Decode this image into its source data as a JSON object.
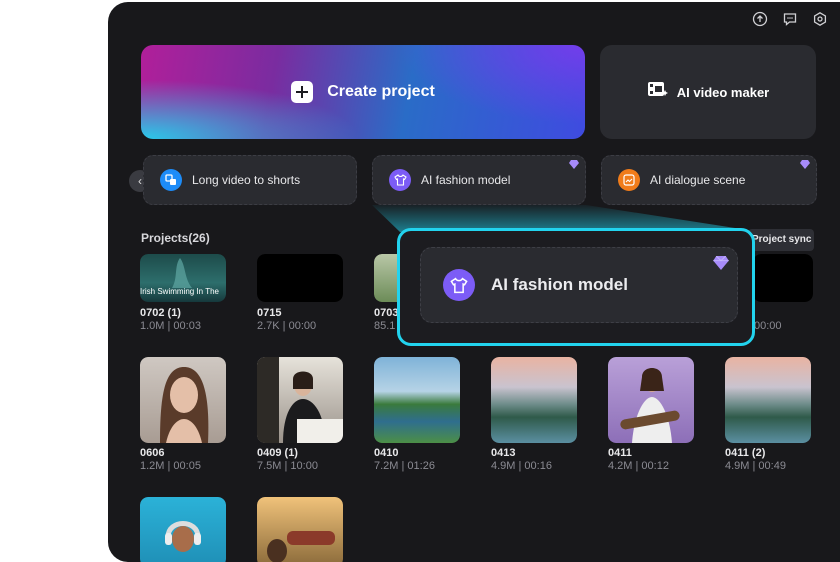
{
  "hero": {
    "create_label": "Create project",
    "ai_video_maker_label": "AI video maker"
  },
  "shortcuts": [
    {
      "label": "Long video to shorts",
      "icon": "scissors-icon",
      "color": "#1d8cf8"
    },
    {
      "label": "AI fashion model",
      "icon": "shirt-icon",
      "color": "#7c5cf6",
      "premium": true
    },
    {
      "label": "AI dialogue scene",
      "icon": "dialogue-icon",
      "color": "#f07c1a",
      "premium": true
    }
  ],
  "projects": {
    "title": "Projects(26)",
    "sync_label": "Project sync",
    "items": [
      {
        "name": "0702 (1)",
        "meta": "1.0M | 00:03",
        "overlay": "Irish Swimming In The"
      },
      {
        "name": "0715",
        "meta": "2.7K | 00:00"
      },
      {
        "name": "0703",
        "meta": "85.1"
      },
      {
        "name": "",
        "meta": "00:00"
      },
      {
        "name": "0606",
        "meta": "1.2M | 00:05"
      },
      {
        "name": "0409 (1)",
        "meta": "7.5M | 10:00"
      },
      {
        "name": "0410",
        "meta": "7.2M | 01:26"
      },
      {
        "name": "0413",
        "meta": "4.9M | 00:16"
      },
      {
        "name": "0411",
        "meta": "4.2M | 00:12"
      },
      {
        "name": "0411 (2)",
        "meta": "4.9M | 00:49"
      }
    ]
  },
  "callout": {
    "label": "AI fashion model"
  },
  "colors": {
    "accent": "#22d3ee",
    "panel": "#18181b",
    "card": "#2a2b30",
    "gem": "#a78bfa"
  }
}
